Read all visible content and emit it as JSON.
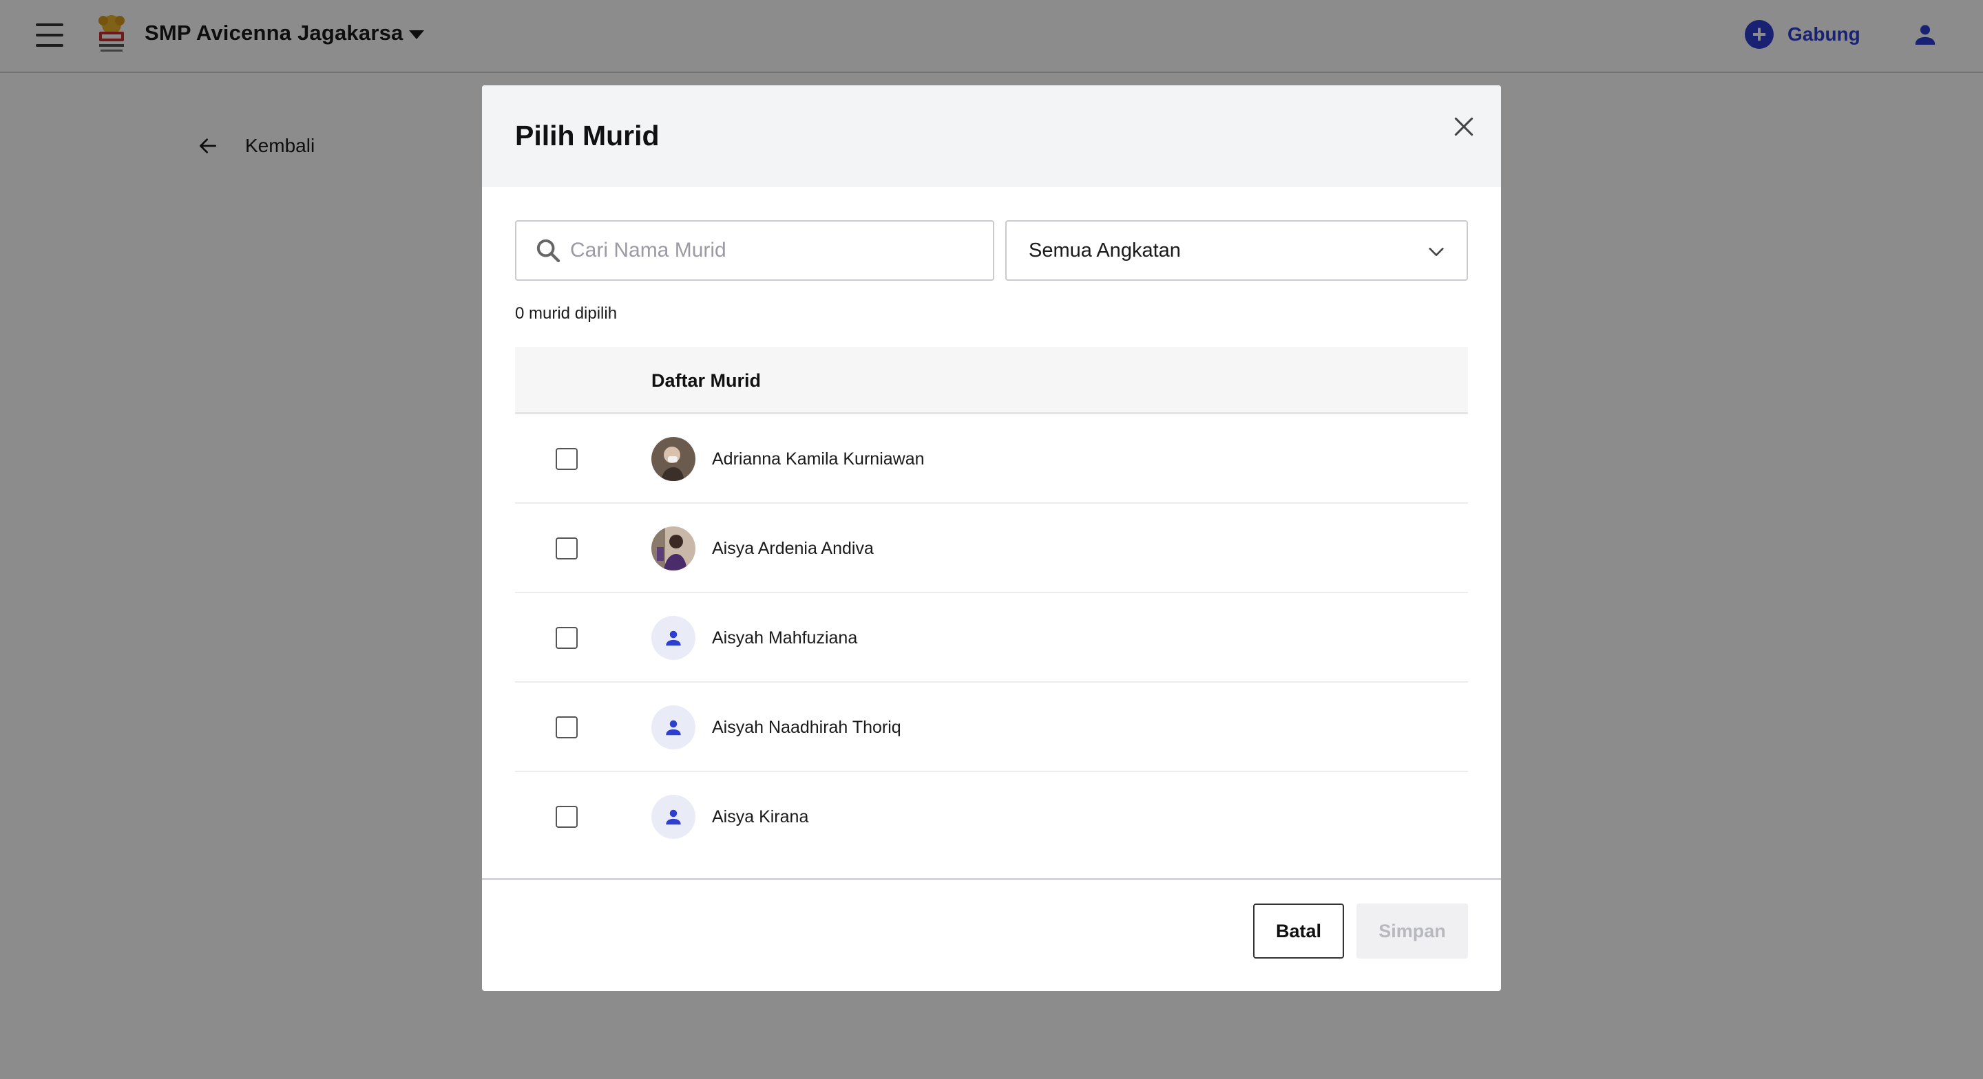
{
  "header": {
    "school_name": "SMP Avicenna Jagakarsa",
    "join_label": "Gabung",
    "join_icon": "plus-circle-icon",
    "user_icon": "person-icon"
  },
  "back": {
    "label": "Kembali",
    "icon": "arrow-left-icon"
  },
  "modal": {
    "title": "Pilih Murid",
    "search": {
      "placeholder": "Cari Nama Murid",
      "value": ""
    },
    "grade_filter": {
      "value": "Semua Angkatan"
    },
    "selected_count": "0 murid dipilih",
    "table": {
      "column_header": "Daftar Murid",
      "rows": [
        {
          "name": "Adrianna Kamila Kurniawan",
          "avatar": "photo",
          "checked": false
        },
        {
          "name": "Aisya Ardenia Andiva",
          "avatar": "photo",
          "checked": false
        },
        {
          "name": "Aisyah Mahfuziana",
          "avatar": "person-icon",
          "checked": false
        },
        {
          "name": "Aisyah Naadhirah Thoriq",
          "avatar": "person-icon",
          "checked": false
        },
        {
          "name": "Aisya Kirana",
          "avatar": "person-icon",
          "checked": false
        }
      ]
    },
    "footer": {
      "cancel_label": "Batal",
      "save_label": "Simpan"
    }
  },
  "colors": {
    "accent": "#2e3fd0",
    "overlay": "rgba(0,0,0,0.45)",
    "modal_header_bg": "#f3f4f6",
    "disabled_text": "#b8b8bf"
  }
}
